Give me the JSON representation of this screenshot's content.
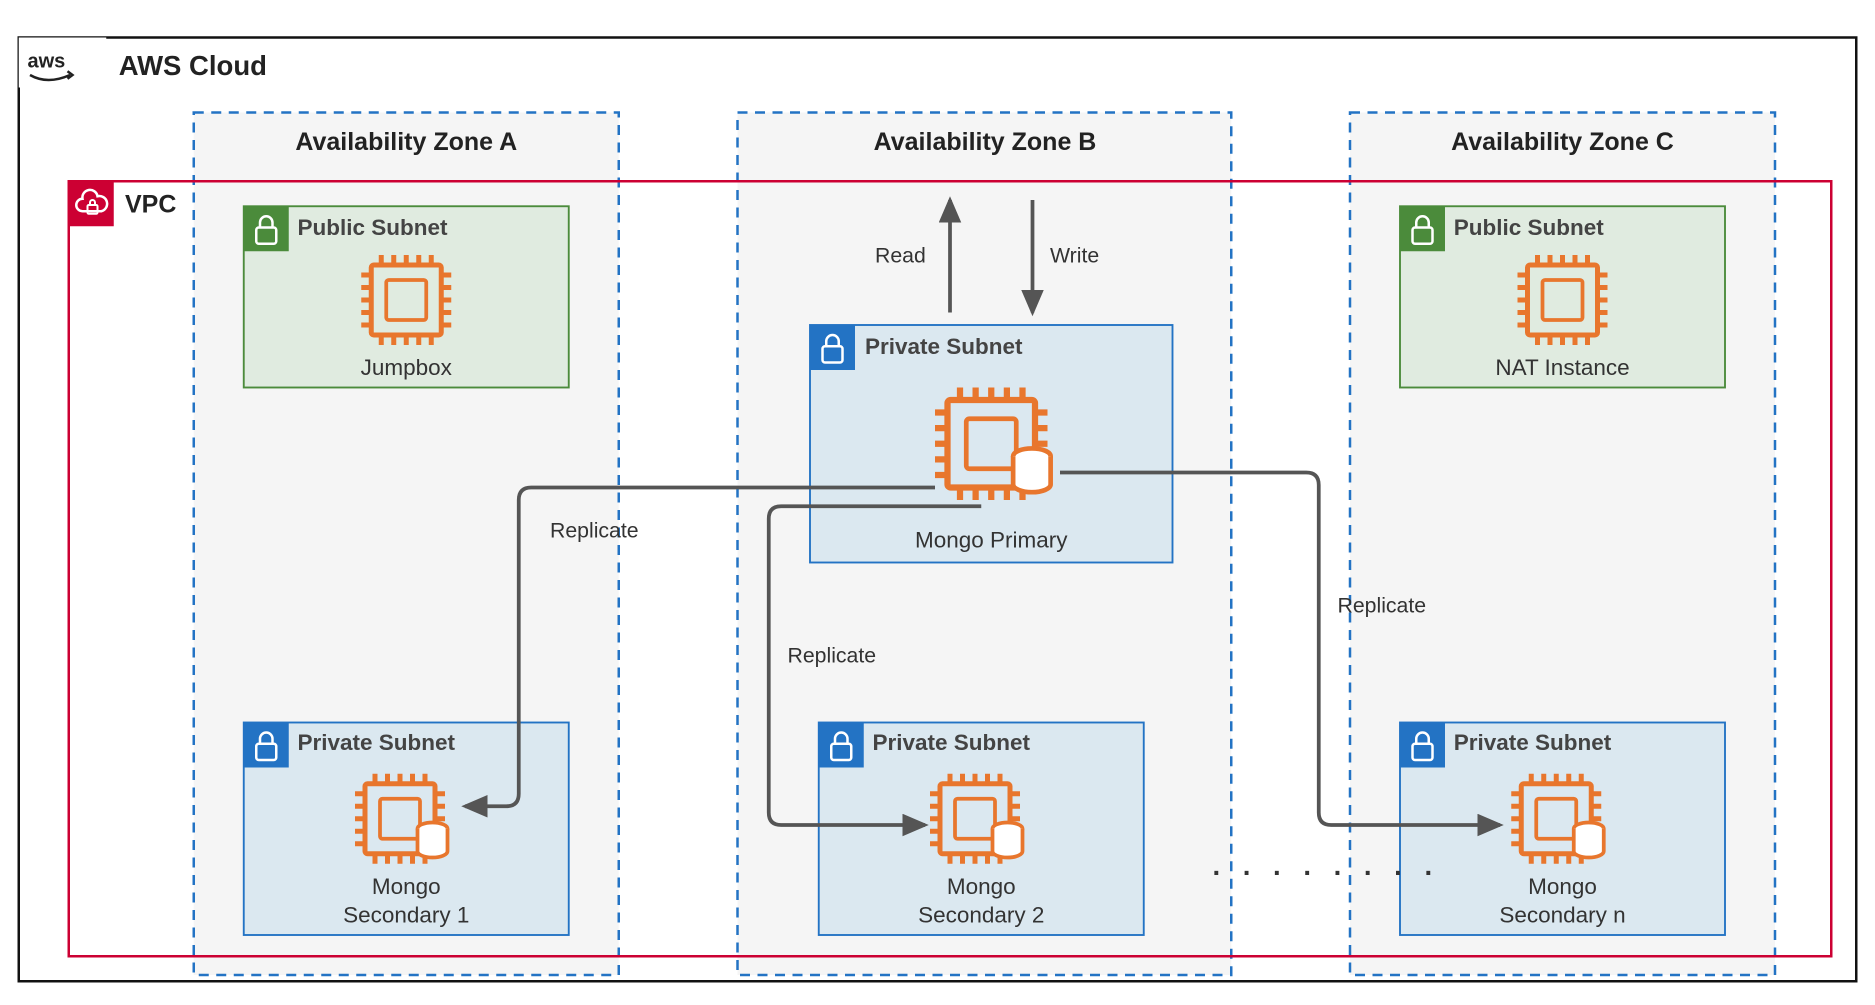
{
  "cloud_label": "AWS Cloud",
  "vpc_label": "VPC",
  "zones": {
    "a": "Availability Zone A",
    "b": "Availability Zone B",
    "c": "Availability Zone C"
  },
  "subnets": {
    "public": "Public Subnet",
    "private": "Private Subnet"
  },
  "nodes": {
    "jumpbox": "Jumpbox",
    "nat": "NAT Instance",
    "primary": "Mongo Primary",
    "sec1_l1": "Mongo",
    "sec1_l2": "Secondary 1",
    "sec2_l1": "Mongo",
    "sec2_l2": "Secondary 2",
    "secn_l1": "Mongo",
    "secn_l2": "Secondary n"
  },
  "flows": {
    "read": "Read",
    "write": "Write",
    "replicate": "Replicate"
  },
  "ellipsis": ". . . . . . . .",
  "colors": {
    "aws_orange": "#e8762d",
    "vpc_red": "#cc0033",
    "public_green": "#4b8b3b",
    "private_blue": "#2373c4"
  }
}
